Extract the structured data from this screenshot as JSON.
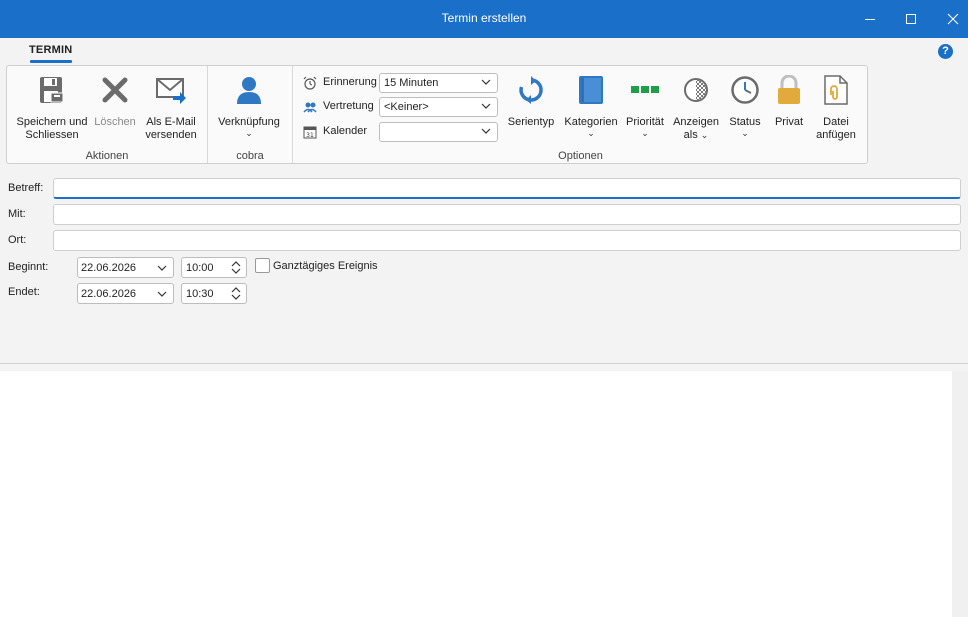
{
  "window": {
    "title": "Termin erstellen"
  },
  "tabs": {
    "active": "TERMIN"
  },
  "ribbon": {
    "groups": {
      "actions_label": "Aktionen",
      "cobra_label": "cobra",
      "options_label": "Optionen"
    },
    "buttons": {
      "save_close_line1": "Speichern und",
      "save_close_line2": "Schliessen",
      "delete": "Löschen",
      "email_line1": "Als E-Mail",
      "email_line2": "versenden",
      "link": "Verknüpfung",
      "series": "Serientyp",
      "categories": "Kategorien",
      "priority": "Priorität",
      "show_as_line1": "Anzeigen",
      "show_as_line2": "als",
      "status": "Status",
      "private": "Privat",
      "attach_line1": "Datei",
      "attach_line2": "anfügen"
    },
    "combos": {
      "reminder_label": "Erinnerung",
      "reminder_value": "15 Minuten",
      "substitute_label": "Vertretung",
      "substitute_value": "<Keiner>",
      "calendar_label": "Kalender",
      "calendar_value": "",
      "calendar_icon_day": "31"
    }
  },
  "form": {
    "subject_label": "Betreff:",
    "subject_value": "",
    "with_label": "Mit:",
    "with_value": "",
    "location_label": "Ort:",
    "location_value": "",
    "start_label": "Beginnt:",
    "start_date": "22.06.2026",
    "start_time": "10:00",
    "end_label": "Endet:",
    "end_date": "22.06.2026",
    "end_time": "10:30",
    "all_day_label": "Ganztägiges Ereignis",
    "all_day_checked": false
  },
  "colors": {
    "accent": "#1a6fc8",
    "priority_green": "#1e9e4a",
    "lock_gold": "#e2a93b"
  }
}
